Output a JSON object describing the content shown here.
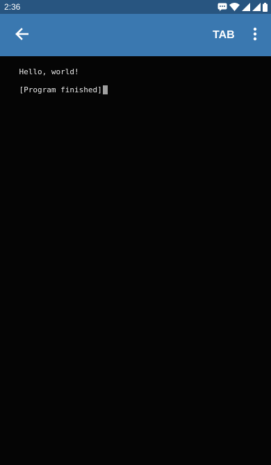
{
  "status_bar": {
    "time": "2:36",
    "icons": [
      "message-icon",
      "wifi-icon",
      "signal-icon",
      "signal-icon",
      "battery-icon"
    ]
  },
  "app_bar": {
    "back_icon": "arrow-left-icon",
    "tab_label": "TAB",
    "overflow_icon": "more-vert-icon"
  },
  "terminal": {
    "lines": [
      "Hello, world!",
      "[Program finished]"
    ]
  },
  "colors": {
    "status_bar": "#285580",
    "app_bar": "#3a78b0",
    "terminal_bg": "#050505",
    "terminal_text": "#e8e8e8",
    "cursor": "#a0a0a0"
  }
}
